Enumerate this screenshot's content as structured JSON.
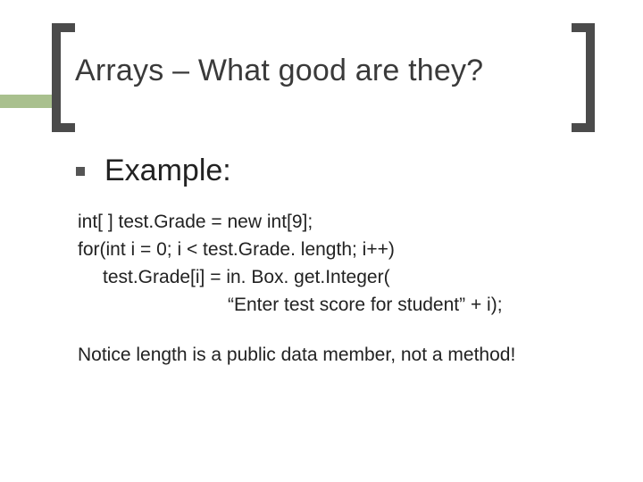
{
  "title": "Arrays – What good are they?",
  "exampleLabel": "Example:",
  "code": {
    "line1": "int[ ] test.Grade = new int[9];",
    "line2": "for(int i = 0; i < test.Grade. length; i++)",
    "line3": "test.Grade[i] = in. Box. get.Integer(",
    "line4": "“Enter test score for student” + i);"
  },
  "note": "Notice length is a public data member, not a method!"
}
